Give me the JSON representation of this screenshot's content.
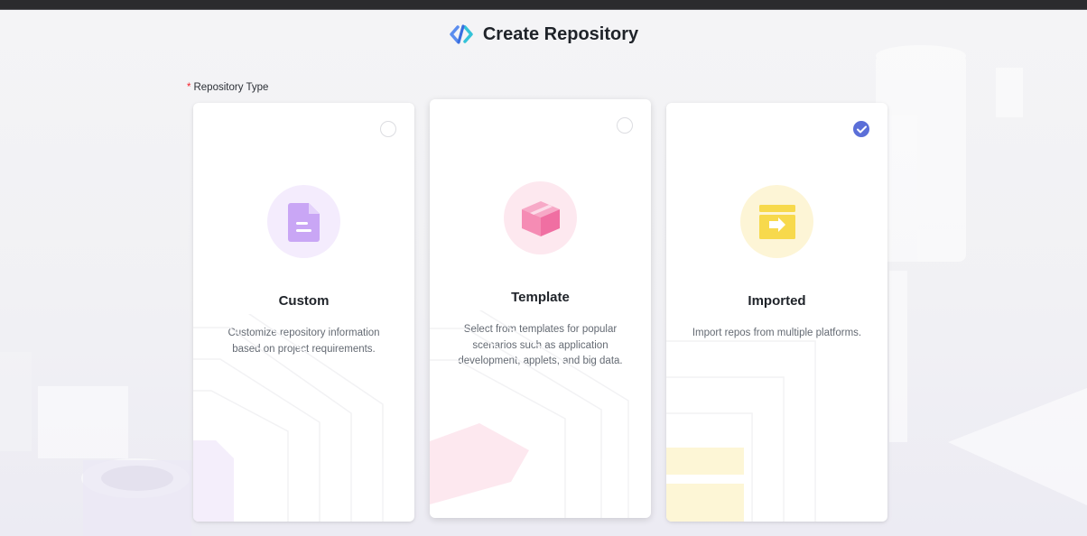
{
  "page": {
    "title": "Create Repository"
  },
  "form": {
    "required_mark": "*",
    "field_label": "Repository Type"
  },
  "cards": [
    {
      "title": "Custom",
      "description": "Customize repository information based on project requirements.",
      "selected": false,
      "icon": "document-icon",
      "accent": "#c9a6f5",
      "bg": "#f4ecfd"
    },
    {
      "title": "Template",
      "description": "Select from templates for popular scenarios such as application development, applets, and big data.",
      "selected": false,
      "icon": "box-icon",
      "accent": "#f58cb4",
      "bg": "#fde8ef"
    },
    {
      "title": "Imported",
      "description": "Import repos from multiple platforms.",
      "selected": true,
      "icon": "import-icon",
      "accent": "#f7d94c",
      "bg": "#fdf5d6"
    }
  ],
  "colors": {
    "selected": "#5b6fd8",
    "required": "#f5222d",
    "text": "#1f2329",
    "muted": "#646a73"
  }
}
